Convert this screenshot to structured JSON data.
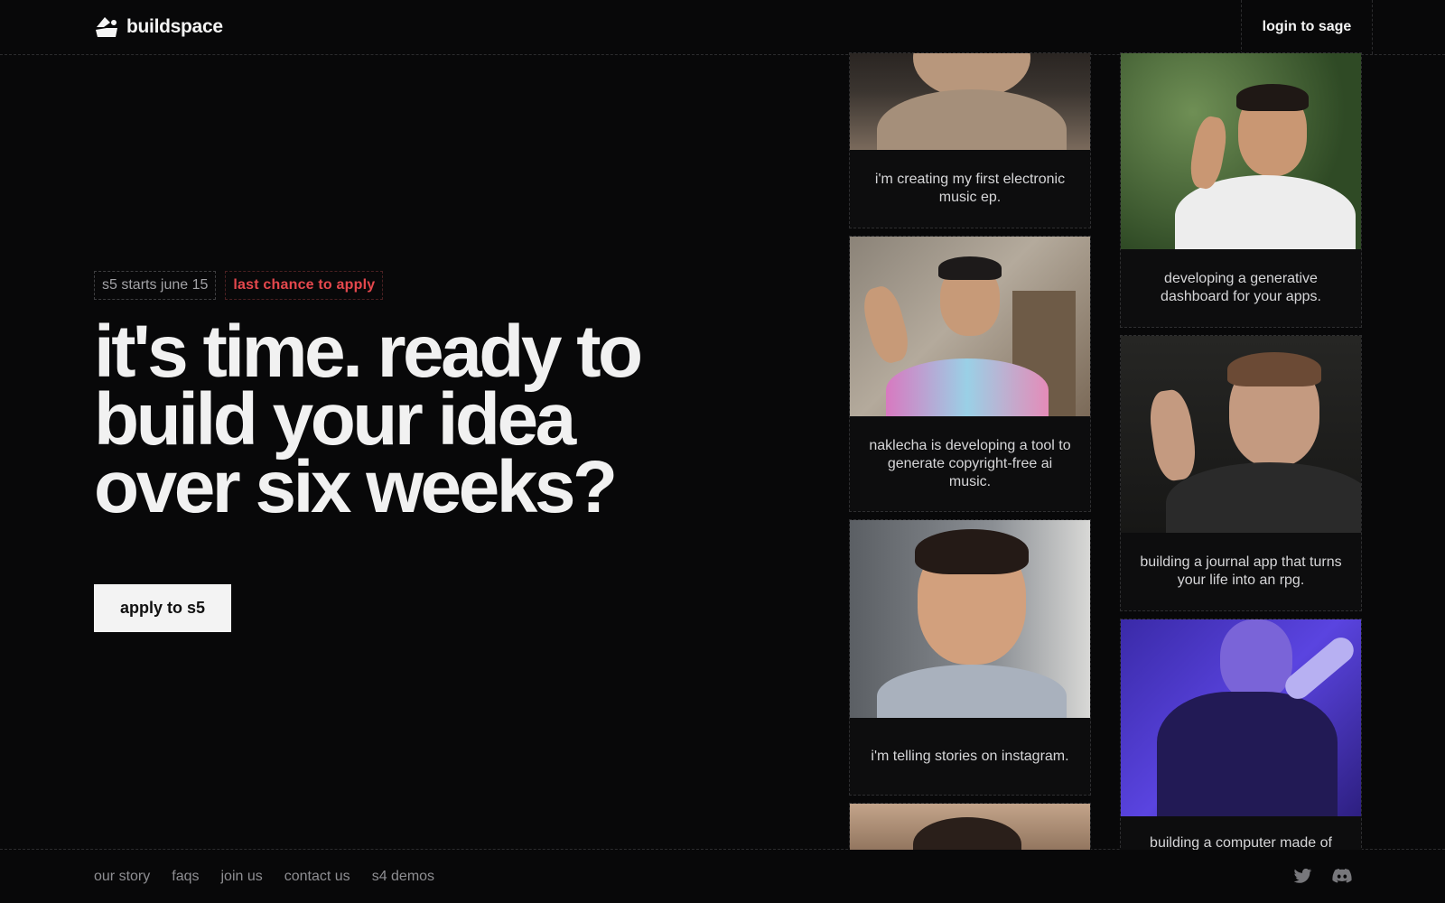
{
  "header": {
    "brand": "buildspace",
    "login_label": "login to sage"
  },
  "hero": {
    "tag_start": "s5 starts june 15",
    "tag_urgent": "last chance to apply",
    "headline_line1": "it's time. ready to",
    "headline_line2": "build your idea",
    "headline_line3": "over six weeks?",
    "cta_label": "apply to s5"
  },
  "cards": {
    "c1": "i'm creating my first electronic music ep.",
    "c2": "naklecha is developing a tool to generate copyright-free ai music.",
    "c3": "i'm telling stories on instagram.",
    "c4": "developing a generative dashboard for your apps.",
    "c5": "building a journal app that turns your life into an rpg.",
    "c6": "building a computer made of"
  },
  "footer": {
    "links": [
      "our story",
      "faqs",
      "join us",
      "contact us",
      "s4 demos"
    ]
  },
  "icons": {
    "logo": "buildspace-logo-icon",
    "twitter": "twitter-icon",
    "discord": "discord-icon"
  },
  "colors": {
    "background": "#080809",
    "urgent": "#e5484d",
    "cta_bg": "#f3f3f3"
  }
}
